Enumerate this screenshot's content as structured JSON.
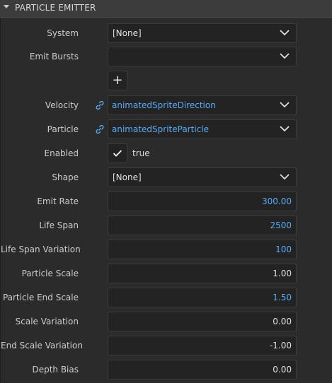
{
  "header": {
    "title": "PARTICLE EMITTER"
  },
  "rows": {
    "system": {
      "label": "System",
      "value": "[None]"
    },
    "emit_bursts": {
      "label": "Emit Bursts",
      "value": ""
    },
    "velocity": {
      "label": "Velocity",
      "value": "animatedSpriteDirection"
    },
    "particle": {
      "label": "Particle",
      "value": "animatedSpriteParticle"
    },
    "enabled": {
      "label": "Enabled",
      "value": "true"
    },
    "shape": {
      "label": "Shape",
      "value": "[None]"
    },
    "emit_rate": {
      "label": "Emit Rate",
      "value": "300.00"
    },
    "life_span": {
      "label": "Life Span",
      "value": "2500"
    },
    "life_span_var": {
      "label": "Life Span Variation",
      "value": "100"
    },
    "particle_scale": {
      "label": "Particle Scale",
      "value": "1.00"
    },
    "particle_end": {
      "label": "Particle End Scale",
      "value": "1.50"
    },
    "scale_var": {
      "label": "Scale Variation",
      "value": "0.00"
    },
    "end_scale_var": {
      "label": "End Scale Variation",
      "value": "-1.00"
    },
    "depth_bias": {
      "label": "Depth Bias",
      "value": "0.00"
    }
  },
  "icons": {
    "collapse": "triangle-down-icon",
    "dropdown": "chevron-down-icon",
    "add": "plus-icon",
    "link": "link-icon",
    "check": "checkmark-icon"
  },
  "colors": {
    "background": "#2b2b2b",
    "field": "#232323",
    "accent_blue": "#5aaaf5",
    "label": "#cdcdcd"
  }
}
